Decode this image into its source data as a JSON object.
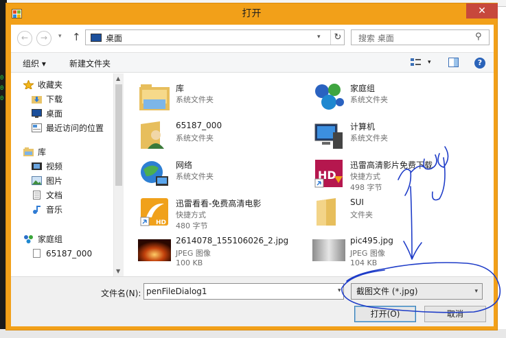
{
  "dialog": {
    "title": "打开",
    "close_glyph": "✕"
  },
  "nav": {
    "back_glyph": "←",
    "forward_glyph": "→",
    "up_glyph": "↑",
    "address": "桌面",
    "search_placeholder": "搜索 桌面",
    "refresh_glyph": "↻",
    "search_glyph": "⚲"
  },
  "toolbar": {
    "organize": "组织 ▾",
    "new_folder": "新建文件夹",
    "help_glyph": "?"
  },
  "sidebar": {
    "items": [
      {
        "label": "收藏夹",
        "icon": "star-icon"
      },
      {
        "label": "下载",
        "icon": "download-folder-icon"
      },
      {
        "label": "桌面",
        "icon": "desktop-icon"
      },
      {
        "label": "最近访问的位置",
        "icon": "recent-places-icon"
      },
      {
        "label": "库",
        "icon": "library-icon"
      },
      {
        "label": "视频",
        "icon": "video-icon"
      },
      {
        "label": "图片",
        "icon": "pictures-icon"
      },
      {
        "label": "文档",
        "icon": "documents-icon"
      },
      {
        "label": "音乐",
        "icon": "music-icon"
      },
      {
        "label": "家庭组",
        "icon": "homegroup-icon"
      },
      {
        "label": "65187_000",
        "icon": "file-icon"
      }
    ]
  },
  "files": [
    {
      "name": "库",
      "line1": "系统文件夹",
      "line2": "",
      "icon": "library-folder-icon"
    },
    {
      "name": "家庭组",
      "line1": "系统文件夹",
      "line2": "",
      "icon": "homegroup-icon"
    },
    {
      "name": "65187_000",
      "line1": "系统文件夹",
      "line2": "",
      "icon": "user-folder-icon"
    },
    {
      "name": "计算机",
      "line1": "系统文件夹",
      "line2": "",
      "icon": "computer-icon"
    },
    {
      "name": "网络",
      "line1": "系统文件夹",
      "line2": "",
      "icon": "network-icon"
    },
    {
      "name": "迅雷高清影片免费下载",
      "line1": "快捷方式",
      "line2": "498 字节",
      "icon": "xunlei-hd-shortcut-icon"
    },
    {
      "name": "迅雷看看-免费高清电影",
      "line1": "快捷方式",
      "line2": "480 字节",
      "icon": "xunlei-kankan-shortcut-icon"
    },
    {
      "name": "SUI",
      "line1": "文件夹",
      "line2": "",
      "icon": "folder-icon"
    },
    {
      "name": "2614078_155106026_2.jpg",
      "line1": "JPEG 图像",
      "line2": "100 KB",
      "icon": "jpeg-thumbnail-icon"
    },
    {
      "name": "pic495.jpg",
      "line1": "JPEG 图像",
      "line2": "104 KB",
      "icon": "jpeg-thumbnail-icon"
    }
  ],
  "footer": {
    "filename_label": "文件名(N):",
    "filename_value": "penFileDialog1",
    "filetype": "截图文件 (*.jpg)",
    "open_button": "打开(O)",
    "cancel_button": "取消"
  },
  "colors": {
    "frame": "#f2a019",
    "close": "#c7483c",
    "ink": "#1e3cc8"
  }
}
